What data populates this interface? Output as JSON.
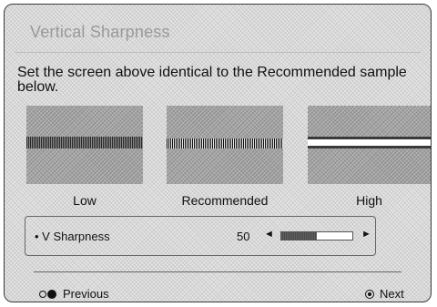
{
  "dialog": {
    "title": "Vertical Sharpness",
    "instruction": "Set the screen above identical to the Recommended sample below."
  },
  "samples": [
    {
      "label": "Low"
    },
    {
      "label": "Recommended"
    },
    {
      "label": "High"
    }
  ],
  "setting": {
    "bullet_label": "• V Sharpness",
    "value": "50",
    "level": 50,
    "max": 100,
    "left_arrow": "◄",
    "right_arrow": "►"
  },
  "navigation": {
    "previous_label": "Previous",
    "previous_icon": "back-return-icon",
    "next_label": "Next",
    "next_icon": "ok-button-icon"
  }
}
